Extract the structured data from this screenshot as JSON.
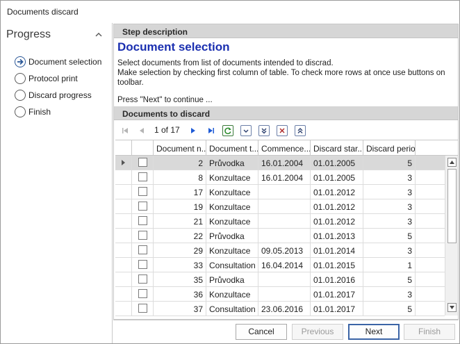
{
  "window": {
    "title": "Documents discard"
  },
  "progress": {
    "header": "Progress",
    "steps": [
      {
        "label": "Document selection",
        "current": true
      },
      {
        "label": "Protocol print",
        "current": false
      },
      {
        "label": "Discard progress",
        "current": false
      },
      {
        "label": "Finish",
        "current": false
      }
    ]
  },
  "step_description": {
    "section_title": "Step description",
    "title": "Document selection",
    "text": "Select documents from list of documents intended to discrad.\nMake selection by checking first column of table. To check more rows at once use buttons on toolbar.",
    "hint": "Press \"Next\" to continue ..."
  },
  "documents": {
    "section_title": "Documents to discard",
    "pager": "1 of 17",
    "columns": [
      "Document n...",
      "Document t...",
      "Commence...",
      "Discard star...",
      "Discard period"
    ],
    "rows": [
      {
        "number": "2",
        "type": "Průvodka",
        "commenced": "16.01.2004",
        "discard_start": "01.01.2005",
        "period": "5",
        "selected": true
      },
      {
        "number": "8",
        "type": "Konzultace",
        "commenced": "16.01.2004",
        "discard_start": "01.01.2005",
        "period": "3"
      },
      {
        "number": "17",
        "type": "Konzultace",
        "commenced": "",
        "discard_start": "01.01.2012",
        "period": "3"
      },
      {
        "number": "19",
        "type": "Konzultace",
        "commenced": "",
        "discard_start": "01.01.2012",
        "period": "3"
      },
      {
        "number": "21",
        "type": "Konzultace",
        "commenced": "",
        "discard_start": "01.01.2012",
        "period": "3"
      },
      {
        "number": "22",
        "type": "Průvodka",
        "commenced": "",
        "discard_start": "01.01.2013",
        "period": "5"
      },
      {
        "number": "29",
        "type": "Konzultace",
        "commenced": "09.05.2013",
        "discard_start": "01.01.2014",
        "period": "3"
      },
      {
        "number": "33",
        "type": "Consultation",
        "commenced": "16.04.2014",
        "discard_start": "01.01.2015",
        "period": "1"
      },
      {
        "number": "35",
        "type": "Průvodka",
        "commenced": "",
        "discard_start": "01.01.2016",
        "period": "5"
      },
      {
        "number": "36",
        "type": "Konzultace",
        "commenced": "",
        "discard_start": "01.01.2017",
        "period": "3"
      },
      {
        "number": "37",
        "type": "Consultation",
        "commenced": "23.06.2016",
        "discard_start": "01.01.2017",
        "period": "5"
      }
    ]
  },
  "buttons": {
    "cancel": "Cancel",
    "previous": "Previous",
    "next": "Next",
    "finish": "Finish"
  },
  "colors": {
    "accent_title": "#1a2fb0",
    "section_bar": "#d6d6d6",
    "selected_row": "#d9d9d9",
    "default_button_border": "#3b64a6",
    "nav_icon_blue": "#1f5bd6"
  },
  "icons": {
    "collapse": "chevron-up-icon",
    "current_step": "arrow-right-circle-icon",
    "toolbar": [
      "first-page-icon",
      "previous-page-icon",
      "next-page-icon",
      "last-page-icon",
      "refresh-icon",
      "check-down-icon",
      "check-all-down-icon",
      "uncheck-icon",
      "check-all-up-icon"
    ]
  }
}
